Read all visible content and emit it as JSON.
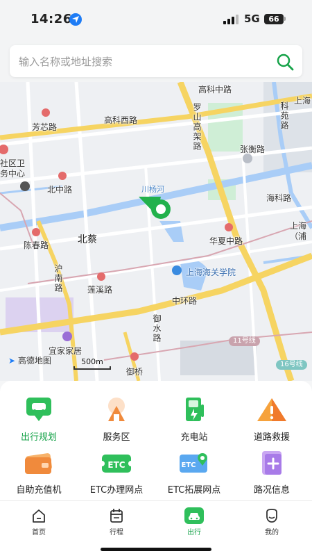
{
  "status": {
    "time": "14:26",
    "network": "5G",
    "battery": "66"
  },
  "search": {
    "placeholder": "输入名称或地址搜索"
  },
  "map": {
    "labels": {
      "gaoke_rd": "高科中路",
      "gaoke_west": "高科西路",
      "fangxin": "芳芯路",
      "luoshan": "罗山高架路",
      "kexiang": "科苑路",
      "shanghai_tr": "上海",
      "zhangheng": "张衡路",
      "community": "社区卫务中心",
      "beizhong": "北中路",
      "chuanyang_river": "川杨河",
      "kelu": "海科路",
      "chenchun": "陈春路",
      "beicai": "北蔡",
      "huaxia": "华夏中路",
      "shanghai_pu": "上海（浦",
      "hunan": "沪南路",
      "customs": "上海海关学院",
      "lianxi": "莲溪路",
      "zhonghuan": "中环路",
      "yushui": "御水路",
      "yijia": "宜家家居",
      "yuqiao": "御桥",
      "metro_11": "11号线",
      "metro_16": "16号线"
    },
    "brand": "高德地图",
    "scale": "500m",
    "marker_color": "#22b14c"
  },
  "services": [
    {
      "label": "出行规划",
      "icon": "car-route-icon",
      "active": true
    },
    {
      "label": "服务区",
      "icon": "service-area-icon",
      "active": false
    },
    {
      "label": "充电站",
      "icon": "charging-station-icon",
      "active": false
    },
    {
      "label": "道路救援",
      "icon": "road-rescue-icon",
      "active": false
    },
    {
      "label": "自助充值机",
      "icon": "recharge-card-icon",
      "active": false
    },
    {
      "label": "ETC办理网点",
      "icon": "etc-outlet-icon",
      "active": false
    },
    {
      "label": "ETC拓展网点",
      "icon": "etc-map-icon",
      "active": false
    },
    {
      "label": "路况信息",
      "icon": "traffic-info-icon",
      "active": false
    }
  ],
  "tabs": [
    {
      "label": "首页",
      "icon": "home-icon",
      "active": false
    },
    {
      "label": "行程",
      "icon": "calendar-icon",
      "active": false
    },
    {
      "label": "出行",
      "icon": "car-icon",
      "active": true
    },
    {
      "label": "我的",
      "icon": "profile-icon",
      "active": false
    }
  ],
  "colors": {
    "accent": "#17a34a",
    "highway": "#f6d462",
    "water": "#a9cdf7",
    "green": "#bfe8c9"
  }
}
